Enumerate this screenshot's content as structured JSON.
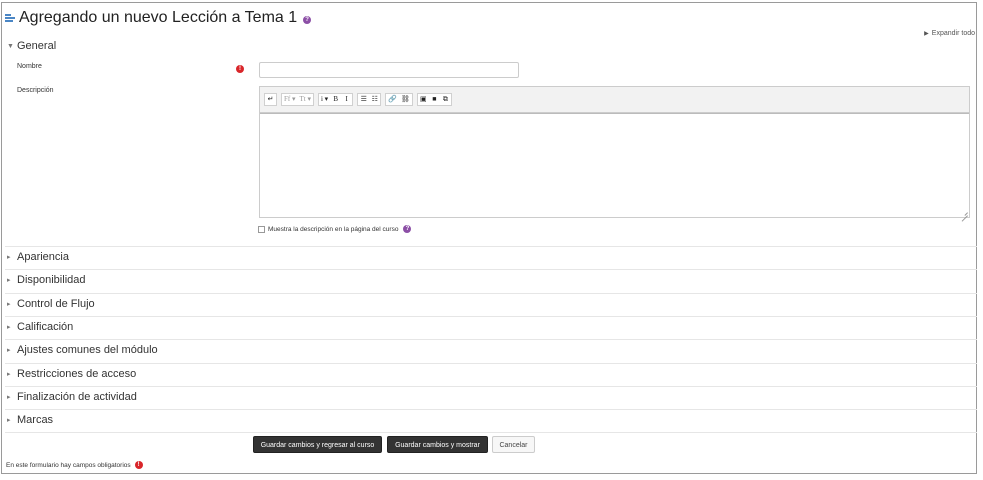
{
  "page": {
    "title": "Agregando un nuevo Lección a Tema 1",
    "expand_all": "Expandir todo"
  },
  "general": {
    "header": "General",
    "name_label": "Nombre",
    "name_value": "",
    "description_label": "Descripción",
    "toolbar": {
      "groups": [
        [
          "↵"
        ],
        [
          "Ff ▾",
          "Tt ▾"
        ],
        [
          "i ▾",
          "B",
          "I"
        ],
        [
          "☰",
          "☷"
        ],
        [
          "🔗",
          "⛓"
        ],
        [
          "▣",
          "■",
          "⧉"
        ]
      ]
    },
    "show_description_label": "Muestra la descripción en la página del curso"
  },
  "sections": [
    "Apariencia",
    "Disponibilidad",
    "Control de Flujo",
    "Calificación",
    "Ajustes comunes del módulo",
    "Restricciones de acceso",
    "Finalización de actividad",
    "Marcas"
  ],
  "buttons": {
    "save_return": "Guardar cambios y regresar al curso",
    "save_display": "Guardar cambios y mostrar",
    "cancel": "Cancelar"
  },
  "footer": {
    "required_note": "En este formulario hay campos obligatorios"
  },
  "colors": {
    "help": "#8c4fa6",
    "required": "#d9262a",
    "primary_button": "#333333"
  }
}
